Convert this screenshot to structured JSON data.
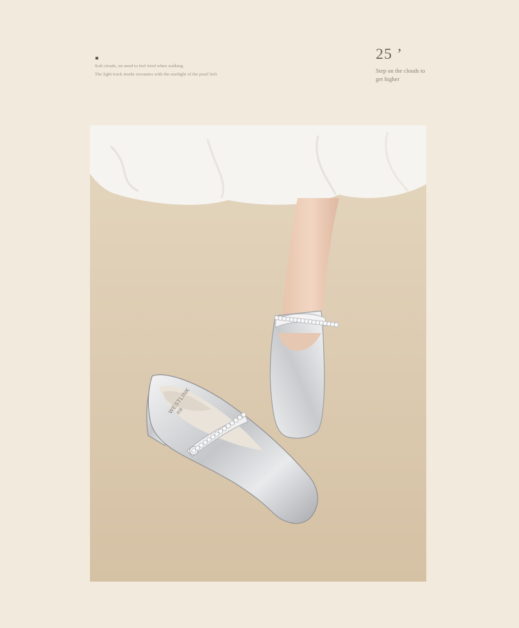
{
  "caption": {
    "line1": "Soft clouds, no need to feel tired when walking",
    "line2": "The light track inside resonates with the starlight of the pearl belt"
  },
  "badge": {
    "number": "25 ’",
    "tagline": "Step on the clouds to get higher"
  },
  "photo": {
    "brand_print": "WESTLINK",
    "brand_sub": "西遇",
    "colors": {
      "background": "#f2ebdd",
      "backdrop": "#d9c7ac",
      "silver": "#c9cbce",
      "skirt": "#f6f4f1"
    }
  }
}
